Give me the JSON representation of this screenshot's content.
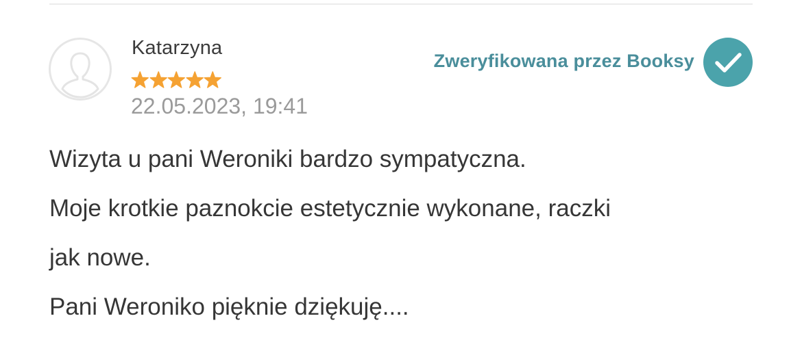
{
  "review": {
    "author": "Katarzyna",
    "rating": 5,
    "rating_max": 5,
    "date": "22.05.2023, 19:41",
    "verified_label": "Zweryfikowana przez Booksy",
    "lines": [
      "Wizyta u pani Weroniki bardzo sympatyczna.",
      "Moje krotkie paznokcie estetycznie wykonane, raczki",
      "jak nowe.",
      "Pani Weroniko pięknie dziękuję...."
    ]
  },
  "icons": {
    "avatar": "user-placeholder-icon",
    "star": "star-icon",
    "verified": "checkmark-circle-icon"
  },
  "colors": {
    "star": "#f5a233",
    "verified_text": "#4a8e9b",
    "verified_badge": "#4ba3ab",
    "date_text": "#9a9a9a"
  }
}
